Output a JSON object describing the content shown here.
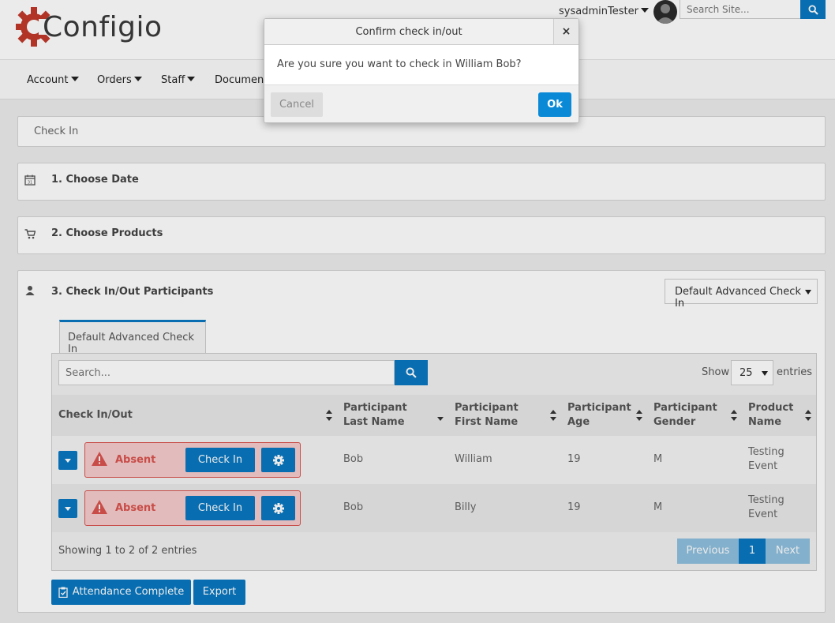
{
  "brand": {
    "name": "Configio",
    "color": "#0a78c0"
  },
  "header": {
    "user": "sysadminTester",
    "search_placeholder": "Search Site..."
  },
  "nav": {
    "items": [
      {
        "label": "Account"
      },
      {
        "label": "Orders"
      },
      {
        "label": "Staff"
      },
      {
        "label": "Documents"
      }
    ]
  },
  "breadcrumb": "Check In",
  "steps": {
    "date": "1. Choose Date",
    "products": "2. Choose Products",
    "participants": "3. Check In/Out Participants"
  },
  "template_select": "Default Advanced Check In",
  "tab_label": "Default Advanced Check In",
  "table": {
    "search_placeholder": "Search...",
    "show_label": "Show",
    "page_size": "25",
    "entries_label": "entries",
    "headers": {
      "checkin": "Check In/Out",
      "last_name": "Participant Last Name",
      "first_name": "Participant First Name",
      "age": "Participant Age",
      "gender": "Participant Gender",
      "product": "Product Name"
    },
    "rows": [
      {
        "status": "Absent",
        "action": "Check In",
        "last_name": "Bob",
        "first_name": "William",
        "age": "19",
        "gender": "M",
        "product": "Testing Event"
      },
      {
        "status": "Absent",
        "action": "Check In",
        "last_name": "Bob",
        "first_name": "Billy",
        "age": "19",
        "gender": "M",
        "product": "Testing Event"
      }
    ],
    "summary": "Showing 1 to 2 of 2 entries",
    "pager": {
      "previous": "Previous",
      "current": "1",
      "next": "Next"
    }
  },
  "actions": {
    "attendance": "Attendance Complete",
    "export": "Export"
  },
  "modal": {
    "title": "Confirm check in/out",
    "close": "×",
    "message": "Are you sure you want to check in William Bob?",
    "cancel": "Cancel",
    "ok": "Ok"
  }
}
